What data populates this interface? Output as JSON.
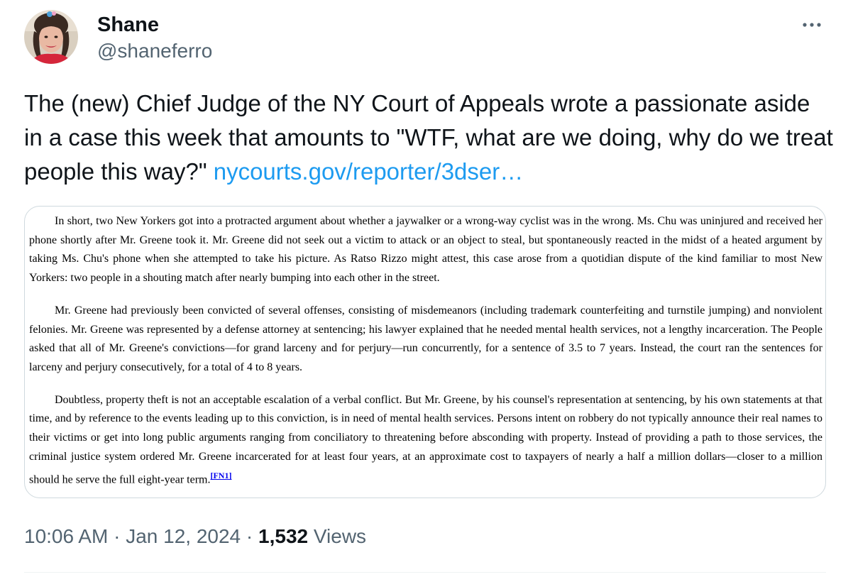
{
  "author": {
    "display_name": "Shane",
    "handle": "@shaneferro",
    "avatar_icon": "profile-photo"
  },
  "more_icon": "more-horizontal-icon",
  "tweet": {
    "text": "The (new) Chief Judge of the NY Court of Appeals wrote a passionate aside in a case this week that amounts to \"WTF, what are we doing, why do we treat people this way?\" ",
    "link_text": "nycourts.gov/reporter/3dser…",
    "link_color": "#1d9bf0"
  },
  "media": {
    "paragraphs": [
      "In short, two New Yorkers got into a protracted argument about whether a jaywalker or a wrong-way cyclist was in the wrong. Ms. Chu was uninjured and received her phone shortly after Mr. Greene took it. Mr. Greene did not seek out a victim to attack or an object to steal, but spontaneously reacted in the midst of a heated argument by taking Ms. Chu's phone when she attempted to take his picture. As Ratso Rizzo might attest, this case arose from a quotidian dispute of the kind familiar to most New Yorkers: two people in a shouting match after nearly bumping into each other in the street.",
      "Mr. Greene had previously been convicted of several offenses, consisting of misdemeanors (including trademark counterfeiting and turnstile jumping) and nonviolent felonies. Mr. Greene was represented by a defense attorney at sentencing; his lawyer explained that he needed mental health services, not a lengthy incarceration. The People asked that all of Mr. Greene's convictions—for grand larceny and for perjury—run concurrently, for a sentence of 3.5 to 7 years. Instead, the court ran the sentences for larceny and perjury consecutively, for a total of 4 to 8 years.",
      "Doubtless, property theft is not an acceptable escalation of a verbal conflict. But Mr. Greene, by his counsel's representation at sentencing, by his own statements at that time, and by reference to the events leading up to this conviction, is in need of mental health services. Persons intent on robbery do not typically announce their real names to their victims or get into long public arguments ranging from conciliatory to threatening before absconding with property. Instead of providing a path to those services, the criminal justice system ordered Mr. Greene incarcerated for at least four years, at an approximate cost to taxpayers of nearly a half a million dollars—closer to a million should he serve the full eight-year term."
    ],
    "footnote": "[FN1]"
  },
  "meta": {
    "time": "10:06 AM",
    "separator": " · ",
    "date": "Jan 12, 2024",
    "views_count": "1,532",
    "views_label": " Views"
  }
}
